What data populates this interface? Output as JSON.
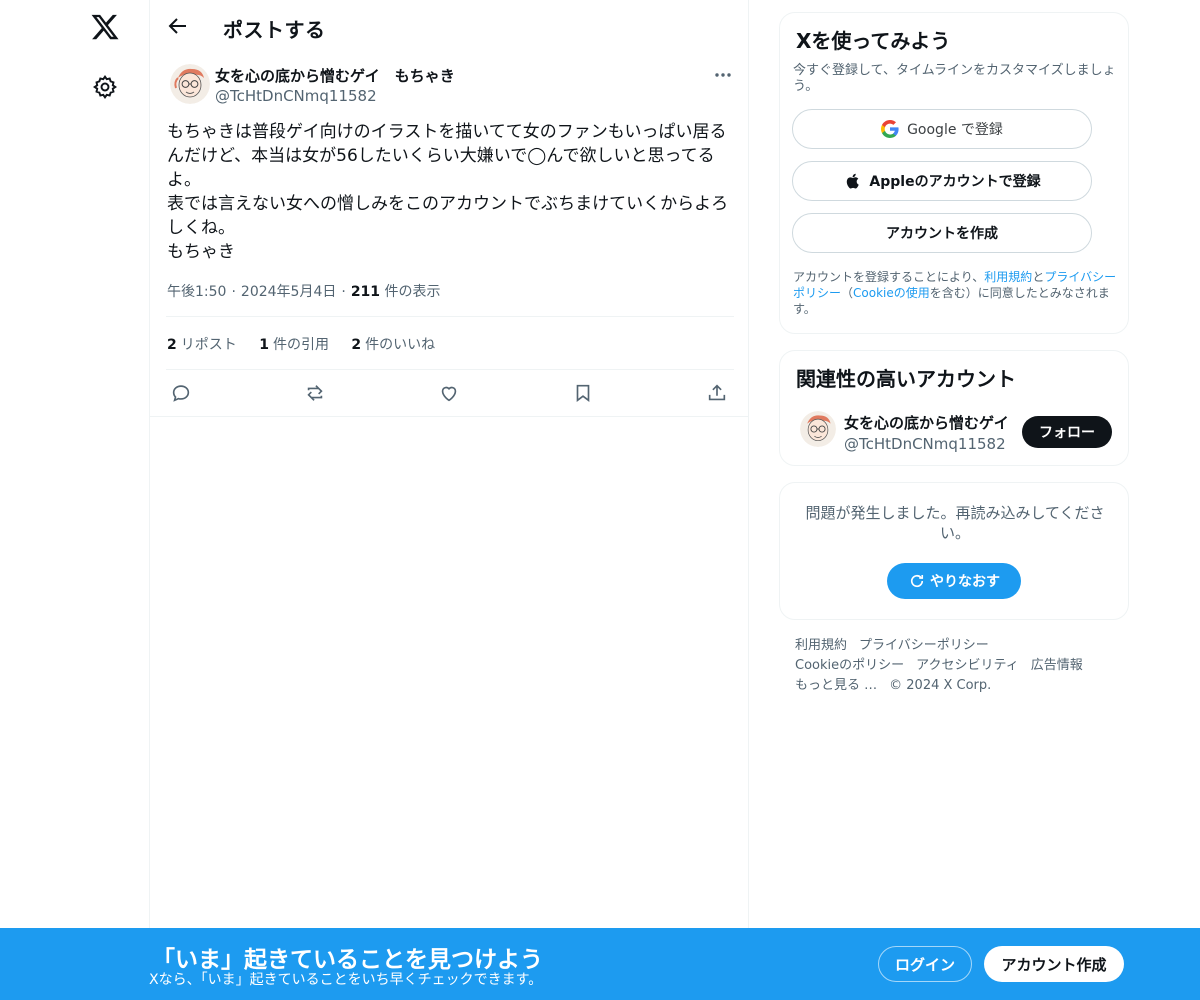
{
  "header": {
    "title": "ポストする"
  },
  "post": {
    "author_name": "女を心の底から憎むゲイ　もちゃき",
    "author_handle": "@TcHtDnCNmq11582",
    "text": "もちゃきは普段ゲイ向けのイラストを描いてて女のファンもいっぱい居るんだけど、本当は女が56したいくらい大嫌いで◯んで欲しいと思ってるよ。\n表では言えない女への憎しみをこのアカウントでぶちまけていくからよろしくね。\nもちゃき",
    "time": "午後1:50",
    "date": "2024年5月4日",
    "views_count": "211",
    "views_label": "件の表示",
    "dot": "·",
    "reposts_count": "2",
    "reposts_label": "リポスト",
    "quotes_count": "1",
    "quotes_label": "件の引用",
    "likes_count": "2",
    "likes_label": "件のいいね"
  },
  "signup_card": {
    "title": "Xを使ってみよう",
    "subtitle": "今すぐ登録して、タイムラインをカスタマイズしましょう。",
    "google_label": "Google で登録",
    "apple_label": "Appleのアカウントで登録",
    "create_label": "アカウントを作成",
    "legal_prefix": "アカウントを登録することにより、",
    "legal_terms": "利用規約",
    "legal_and": "と",
    "legal_privacy": "プライバシーポリシー",
    "legal_paren_open": "（",
    "legal_cookie": "Cookieの使用",
    "legal_suffix": "を含む）に同意したとみなされます。"
  },
  "related": {
    "title": "関連性の高いアカウント",
    "name": "女を心の底から憎むゲイ",
    "handle": "@TcHtDnCNmq11582",
    "follow_label": "フォロー"
  },
  "error_card": {
    "message": "問題が発生しました。再読み込みしてください。",
    "retry_label": "やりなおす"
  },
  "footer": {
    "terms": "利用規約",
    "privacy": "プライバシーポリシー",
    "cookie": "Cookieのポリシー",
    "accessibility": "アクセシビリティ",
    "ads": "広告情報",
    "more": "もっと見る …",
    "copyright": "© 2024 X Corp."
  },
  "bottom_bar": {
    "title": "「いま」起きていることを見つけよう",
    "subtitle": "Xなら、「いま」起きていることをいち早くチェックできます。",
    "login_label": "ログイン",
    "signup_label": "アカウント作成"
  },
  "colors": {
    "accent": "#1d9bf0",
    "text": "#0f1419",
    "muted": "#536471",
    "border": "#eff3f4"
  },
  "icons": [
    "x-logo-icon",
    "gear-icon",
    "back-arrow-icon",
    "more-icon",
    "reply-icon",
    "repost-icon",
    "like-icon",
    "bookmark-icon",
    "share-icon",
    "google-icon",
    "apple-icon",
    "refresh-icon"
  ]
}
